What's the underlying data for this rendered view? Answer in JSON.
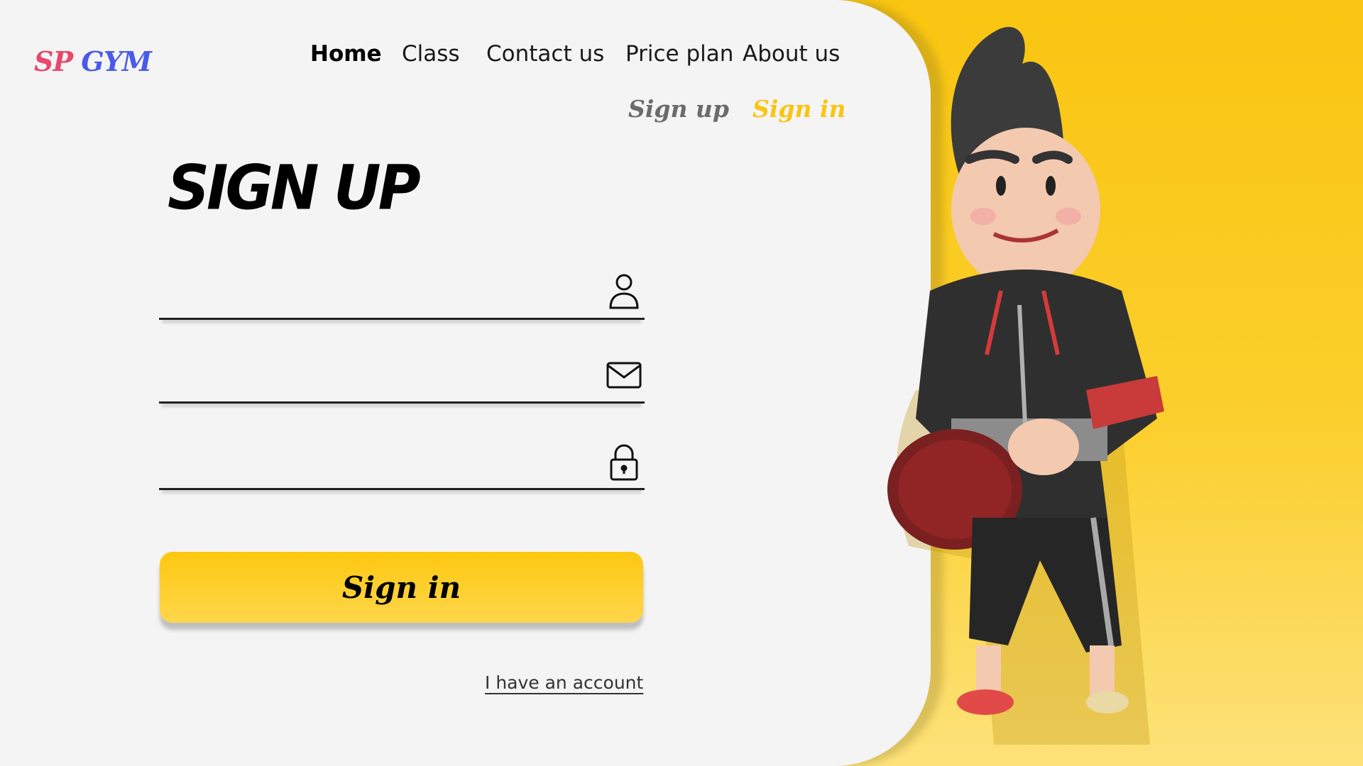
{
  "brand": {
    "part1": "SP",
    "part2": "GYM",
    "color1": "#e8486d",
    "color2": "#4b5be8"
  },
  "nav": {
    "items": [
      "Home",
      "Class",
      "Contact us",
      "Price plan",
      "About us"
    ],
    "active": "Home"
  },
  "auth": {
    "signup_label": "Sign up",
    "signin_label": "Sign in",
    "signup_color": "#6b6b6b",
    "signin_color": "#f9c511"
  },
  "form": {
    "heading": "SIGN UP",
    "fields": [
      {
        "icon": "user-icon",
        "value": ""
      },
      {
        "icon": "envelope-icon",
        "value": ""
      },
      {
        "icon": "lock-icon",
        "value": ""
      }
    ],
    "submit_label": "Sign in",
    "account_link": "I have an account"
  },
  "colors": {
    "accent": "#f9c511",
    "panel": "#f4f4f4"
  },
  "hero": {
    "icon": "gym-character-illustration"
  }
}
